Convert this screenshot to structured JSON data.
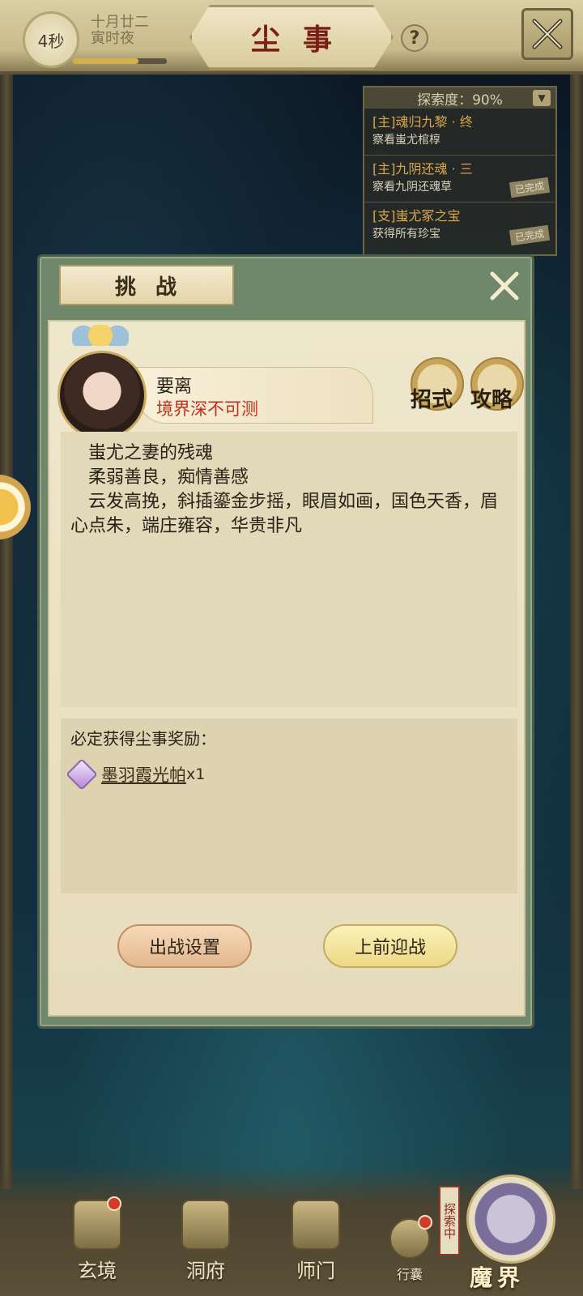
{
  "topbar": {
    "timer": "4秒",
    "date_line1": "十月廿二",
    "date_line2": "寅时夜",
    "time_progress": 0.7,
    "title": "尘事",
    "help_label": "?"
  },
  "quest_panel": {
    "header": "探索度：90%",
    "items": [
      {
        "title": "[主]魂归九黎 · 终",
        "desc": "察看蚩尤棺椁",
        "badge": ""
      },
      {
        "title": "[主]九阴还魂 · 三",
        "desc": "察看九阴还魂草",
        "badge": "已完成"
      },
      {
        "title": "[支]蚩尤冢之宝",
        "desc": "获得所有珍宝",
        "badge": "已完成"
      }
    ]
  },
  "dialog": {
    "title": "挑战",
    "npc": {
      "name": "要离",
      "realm": "境界深不可测"
    },
    "skills_label": "招式",
    "guide_label": "攻略",
    "description": [
      "蚩尤之妻的残魂",
      "柔弱善良，痴情善感",
      "云发高挽，斜插鎏金步摇，眼眉如画，国色天香，眉心点朱，端庄雍容，华贵非凡"
    ],
    "reward_title": "必定获得尘事奖励：",
    "reward": {
      "name": "墨羽霞光帕",
      "count": "x1"
    },
    "setup_button": "出战设置",
    "fight_button": "上前迎战"
  },
  "bottom_nav": [
    {
      "label": "玄境"
    },
    {
      "label": "洞府"
    },
    {
      "label": "师门"
    },
    {
      "label": "行囊"
    }
  ],
  "magic_realm": {
    "label": "魔界",
    "tag": "探索中"
  },
  "colors": {
    "dialog_frame": "#6f876a",
    "paper": "#efe7cc",
    "accent_red": "#c0301e",
    "title_red": "#7a1f17"
  }
}
